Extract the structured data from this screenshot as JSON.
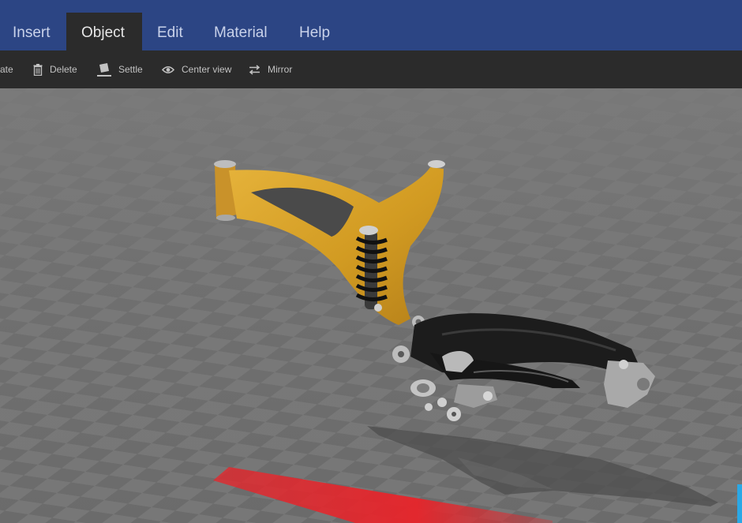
{
  "menu": {
    "tabs": [
      {
        "label": "Insert"
      },
      {
        "label": "Object"
      },
      {
        "label": "Edit"
      },
      {
        "label": "Material"
      },
      {
        "label": "Help"
      }
    ],
    "active": "Object"
  },
  "toolbar": {
    "rotate_partial": "ate",
    "delete": "Delete",
    "settle": "Settle",
    "center_view": "Center view",
    "mirror": "Mirror"
  },
  "icons": {
    "delete": "trash-icon",
    "settle": "settle-icon",
    "center_view": "eye-icon",
    "mirror": "mirror-arrows-icon"
  },
  "colors": {
    "menu_bg": "#2c4584",
    "toolbar_bg": "#2b2b2b",
    "frame_front": "#d9a227",
    "frame_rear": "#1a1a1a",
    "floor_highlight": "#e8242a"
  }
}
